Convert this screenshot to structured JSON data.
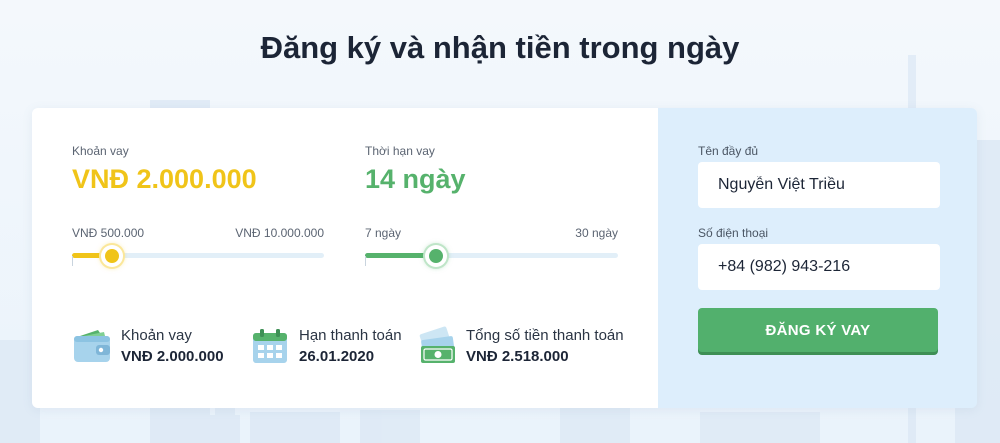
{
  "page": {
    "title": "Đăng ký và nhận tiền trong ngày"
  },
  "calculator": {
    "amount": {
      "label": "Khoản vay",
      "value": "VNĐ 2.000.000",
      "min_label": "VNĐ 500.000",
      "max_label": "VNĐ 10.000.000",
      "slider_fraction": 0.16,
      "color": "#f0c419"
    },
    "term": {
      "label": "Thời hạn vay",
      "value": "14 ngày",
      "min_label": "7 ngày",
      "max_label": "30 ngày",
      "slider_fraction": 0.28,
      "color": "#56b26c"
    },
    "summary": [
      {
        "icon": "wallet-icon",
        "label": "Khoản vay",
        "value": "VNĐ 2.000.000"
      },
      {
        "icon": "calendar-icon",
        "label": "Hạn thanh toán",
        "value": "26.01.2020"
      },
      {
        "icon": "money-icon",
        "label": "Tổng số tiền thanh toán",
        "value": "VNĐ 2.518.000"
      }
    ]
  },
  "form": {
    "name_label": "Tên đầy đủ",
    "name_value": "Nguyễn Việt Triều",
    "phone_label": "Số điện thoại",
    "phone_value": "+84 (982) 943-216",
    "submit_label": "ĐĂNG KÝ VAY",
    "accent_color": "#52b06d",
    "panel_color": "#ddeefc"
  }
}
